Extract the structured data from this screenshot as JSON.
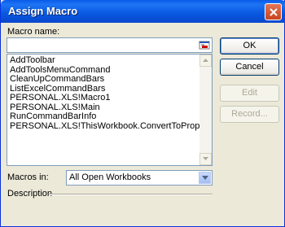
{
  "window": {
    "title": "Assign Macro"
  },
  "macro_name": {
    "label": "Macro name:",
    "value": ""
  },
  "macros": [
    "AddToolbar",
    "AddToolsMenuCommand",
    "CleanUpCommandBars",
    "ListExcelCommandBars",
    "PERSONAL.XLS!Macro1",
    "PERSONAL.XLS!Main",
    "RunCommandBarInfo",
    "PERSONAL.XLS!ThisWorkbook.ConvertToProper"
  ],
  "buttons": {
    "ok": "OK",
    "cancel": "Cancel",
    "edit": "Edit",
    "record": "Record..."
  },
  "macros_in": {
    "label": "Macros in:",
    "value": "All Open Workbooks"
  },
  "description": {
    "label": "Description"
  },
  "icons": {
    "close": "close-icon",
    "refedit": "collapse-dialog-icon",
    "scroll_up": "scroll-up-arrow-icon",
    "scroll_down": "scroll-down-arrow-icon",
    "dropdown": "chevron-down-icon"
  }
}
